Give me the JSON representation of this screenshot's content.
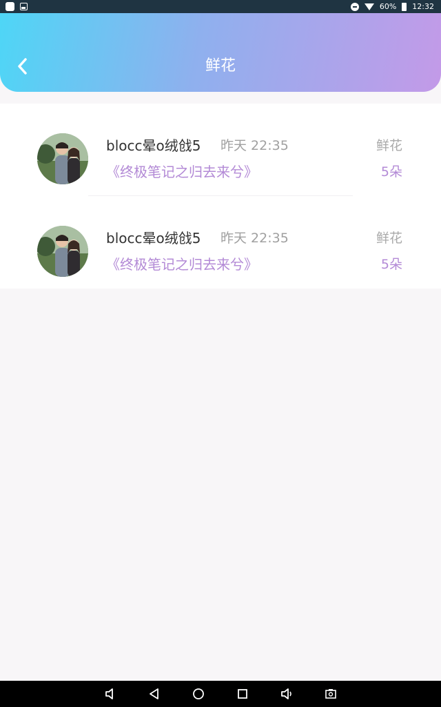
{
  "status_bar": {
    "battery": "60%",
    "time": "12:32",
    "icons": [
      "app-icon",
      "image-icon",
      "dnd-icon",
      "wifi-icon",
      "battery-icon"
    ]
  },
  "header": {
    "title": "鲜花",
    "back_icon": "chevron-left-icon",
    "colors": {
      "gradient_start": "#4ed6f6",
      "gradient_end": "#c39ae8"
    }
  },
  "records": [
    {
      "username": "blocc晕o绒戗5",
      "time": "昨天 22:35",
      "book": "《终极笔记之归去来兮》",
      "gift_type": "鲜花",
      "gift_count": "5朵"
    },
    {
      "username": "blocc晕o绒戗5",
      "time": "昨天 22:35",
      "book": "《终极笔记之归去来兮》",
      "gift_type": "鲜花",
      "gift_count": "5朵"
    }
  ],
  "colors": {
    "accent_purple": "#b38ad6",
    "muted_gray": "#a0a0a0",
    "page_bg": "#f8f6f8"
  },
  "nav_bar": {
    "icons": [
      "volume-down-icon",
      "back-triangle-icon",
      "home-circle-icon",
      "recents-square-icon",
      "volume-up-icon",
      "screenshot-icon"
    ]
  }
}
